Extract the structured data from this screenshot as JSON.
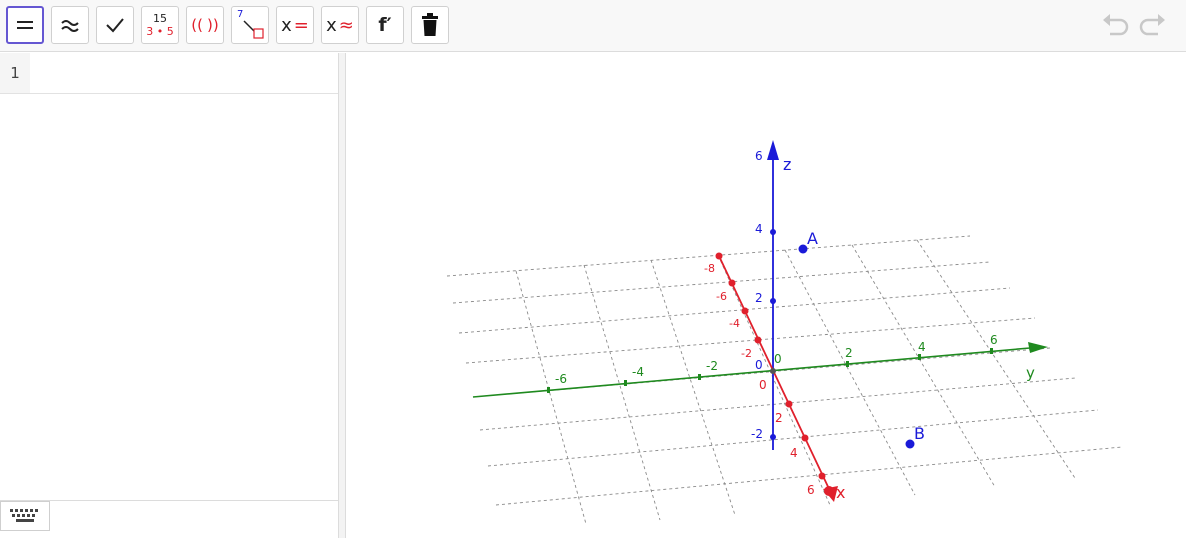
{
  "toolbar": {
    "frac_num": "15",
    "frac_den_a": "3",
    "frac_den_b": "5",
    "paren_open": "((",
    "paren_close": "))",
    "num_to_unit_digit": "7",
    "eval_x": "x",
    "numeric_x": "x",
    "derivative_label": "f′"
  },
  "algebra": {
    "row_number": "1"
  },
  "view3d": {
    "axes": {
      "x": {
        "label": "x",
        "color": "#e0202c",
        "ticks": [
          "-8",
          "-6",
          "-4",
          "-2",
          "0",
          "2",
          "4",
          "6"
        ]
      },
      "y": {
        "label": "y",
        "color": "#1f8a1f",
        "ticks": [
          "-6",
          "-4",
          "-2",
          "0",
          "2",
          "4",
          "6"
        ]
      },
      "z": {
        "label": "z",
        "color": "#1a1ad8",
        "ticks": [
          "-2",
          "0",
          "2",
          "4",
          "6"
        ]
      }
    },
    "points": [
      {
        "name": "A",
        "color": "#1a1ad8"
      },
      {
        "name": "B",
        "color": "#1a1ad8"
      }
    ]
  }
}
